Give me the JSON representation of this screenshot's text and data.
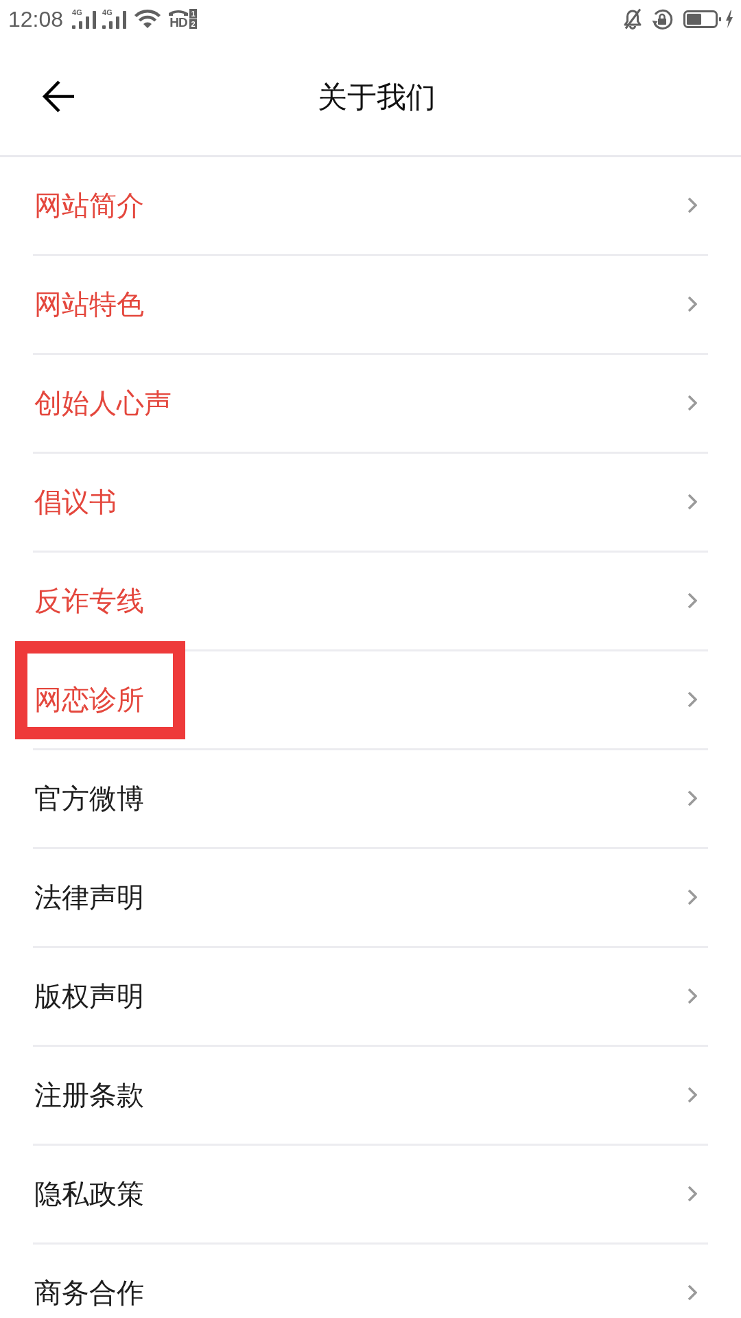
{
  "status_bar": {
    "time": "12:08",
    "networks": [
      {
        "label": "4G"
      },
      {
        "label": "4G"
      }
    ],
    "hd_badge": {
      "label": "HD",
      "slots": [
        "1",
        "2"
      ]
    }
  },
  "header": {
    "title": "关于我们"
  },
  "items": [
    {
      "label": "网站简介",
      "color": "#e4473d",
      "boxed": false
    },
    {
      "label": "网站特色",
      "color": "#e4473d",
      "boxed": false
    },
    {
      "label": "创始人心声",
      "color": "#e4473d",
      "boxed": false
    },
    {
      "label": "倡议书",
      "color": "#e4473d",
      "boxed": false
    },
    {
      "label": "反诈专线",
      "color": "#e4473d",
      "boxed": false
    },
    {
      "label": "网恋诊所",
      "color": "#e4473d",
      "boxed": true
    },
    {
      "label": "官方微博",
      "color": "#1e1e1e",
      "boxed": false
    },
    {
      "label": "法律声明",
      "color": "#1e1e1e",
      "boxed": false
    },
    {
      "label": "版权声明",
      "color": "#1e1e1e",
      "boxed": false
    },
    {
      "label": "注册条款",
      "color": "#1e1e1e",
      "boxed": false
    },
    {
      "label": "隐私政策",
      "color": "#1e1e1e",
      "boxed": false
    },
    {
      "label": "商务合作",
      "color": "#1e1e1e",
      "boxed": false
    }
  ]
}
